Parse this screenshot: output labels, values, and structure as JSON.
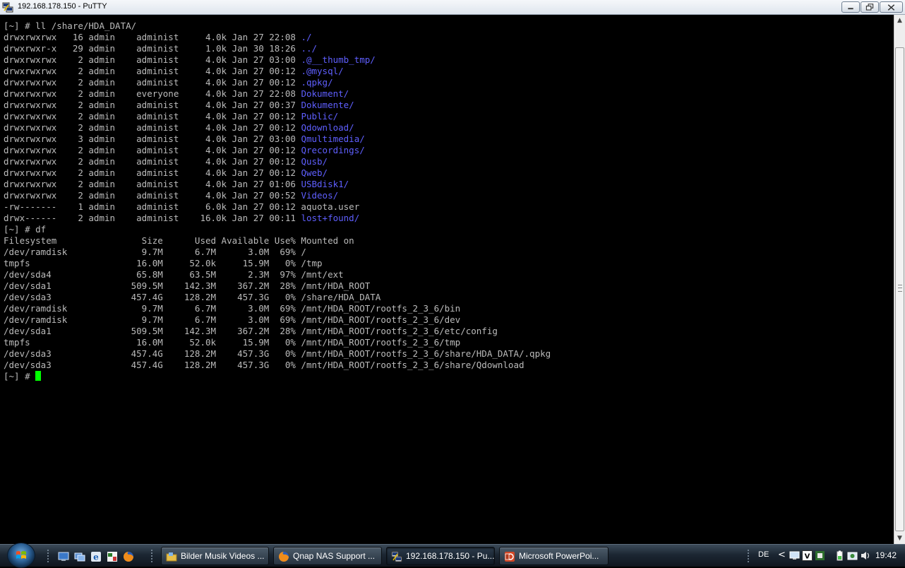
{
  "window": {
    "title": "192.168.178.150 - PuTTY"
  },
  "terminal": {
    "lines": [
      {
        "text": "[~] # ll /share/HDA_DATA/"
      },
      {
        "text": "drwxrwxrwx   16 admin    administ     4.0k Jan 27 22:08 ",
        "name": "./"
      },
      {
        "text": "drwxrwxr-x   29 admin    administ     1.0k Jan 30 18:26 ",
        "name": "../"
      },
      {
        "text": "drwxrwxrwx    2 admin    administ     4.0k Jan 27 03:00 ",
        "name": ".@__thumb_tmp/"
      },
      {
        "text": "drwxrwxrwx    2 admin    administ     4.0k Jan 27 00:12 ",
        "name": ".@mysql/"
      },
      {
        "text": "drwxrwxrwx    2 admin    administ     4.0k Jan 27 00:12 ",
        "name": ".qpkg/"
      },
      {
        "text": "drwxrwxrwx    2 admin    everyone     4.0k Jan 27 22:08 ",
        "name": "Dokument/"
      },
      {
        "text": "drwxrwxrwx    2 admin    administ     4.0k Jan 27 00:37 ",
        "name": "Dokumente/"
      },
      {
        "text": "drwxrwxrwx    2 admin    administ     4.0k Jan 27 00:12 ",
        "name": "Public/"
      },
      {
        "text": "drwxrwxrwx    2 admin    administ     4.0k Jan 27 00:12 ",
        "name": "Qdownload/"
      },
      {
        "text": "drwxrwxrwx    3 admin    administ     4.0k Jan 27 03:00 ",
        "name": "Qmultimedia/"
      },
      {
        "text": "drwxrwxrwx    2 admin    administ     4.0k Jan 27 00:12 ",
        "name": "Qrecordings/"
      },
      {
        "text": "drwxrwxrwx    2 admin    administ     4.0k Jan 27 00:12 ",
        "name": "Qusb/"
      },
      {
        "text": "drwxrwxrwx    2 admin    administ     4.0k Jan 27 00:12 ",
        "name": "Qweb/"
      },
      {
        "text": "drwxrwxrwx    2 admin    administ     4.0k Jan 27 01:06 ",
        "name": "USBdisk1/"
      },
      {
        "text": "drwxrwxrwx    2 admin    administ     4.0k Jan 27 00:52 ",
        "name": "Videos/"
      },
      {
        "text": "-rw-------    1 admin    administ     6.0k Jan 27 00:12 aquota.user"
      },
      {
        "text": "drwx------    2 admin    administ    16.0k Jan 27 00:11 ",
        "name": "lost+found/"
      },
      {
        "text": "[~] # df"
      },
      {
        "text": "Filesystem                Size      Used Available Use% Mounted on"
      },
      {
        "text": "/dev/ramdisk              9.7M      6.7M      3.0M  69% /"
      },
      {
        "text": "tmpfs                    16.0M     52.0k     15.9M   0% /tmp"
      },
      {
        "text": "/dev/sda4                65.8M     63.5M      2.3M  97% /mnt/ext"
      },
      {
        "text": "/dev/sda1               509.5M    142.3M    367.2M  28% /mnt/HDA_ROOT"
      },
      {
        "text": "/dev/sda3               457.4G    128.2M    457.3G   0% /share/HDA_DATA"
      },
      {
        "text": "/dev/ramdisk              9.7M      6.7M      3.0M  69% /mnt/HDA_ROOT/rootfs_2_3_6/bin"
      },
      {
        "text": "/dev/ramdisk              9.7M      6.7M      3.0M  69% /mnt/HDA_ROOT/rootfs_2_3_6/dev"
      },
      {
        "text": "/dev/sda1               509.5M    142.3M    367.2M  28% /mnt/HDA_ROOT/rootfs_2_3_6/etc/config"
      },
      {
        "text": "tmpfs                    16.0M     52.0k     15.9M   0% /mnt/HDA_ROOT/rootfs_2_3_6/tmp"
      },
      {
        "text": "/dev/sda3               457.4G    128.2M    457.3G   0% /mnt/HDA_ROOT/rootfs_2_3_6/share/HDA_DATA/.qpkg"
      },
      {
        "text": "/dev/sda3               457.4G    128.2M    457.3G   0% /mnt/HDA_ROOT/rootfs_2_3_6/share/Qdownload"
      },
      {
        "text": "[~] # ",
        "cursor": true
      }
    ],
    "colors": {
      "foreground": "#bbbbbb",
      "directory": "#5f5fff",
      "cursor": "#00ff00",
      "background": "#000000"
    }
  },
  "taskbar": {
    "quick_launch_icons": [
      "desktop-icon",
      "explorer-icon",
      "ie-icon",
      "app-icon",
      "firefox-icon"
    ],
    "tasks": [
      {
        "label": "Bilder Musik Videos ...",
        "icon": "folder-icon",
        "active": false
      },
      {
        "label": "Qnap NAS Support ...",
        "icon": "firefox-icon",
        "active": false
      },
      {
        "label": "192.168.178.150 - Pu...",
        "icon": "putty-icon",
        "active": true
      },
      {
        "label": "Microsoft PowerPoi...",
        "icon": "powerpoint-icon",
        "active": false
      }
    ],
    "tray": {
      "language": "DE",
      "clock": "19:42",
      "icons": [
        "network-icon",
        "vmware-icon",
        "battery-icon",
        "security-icon",
        "volume-icon"
      ]
    }
  }
}
